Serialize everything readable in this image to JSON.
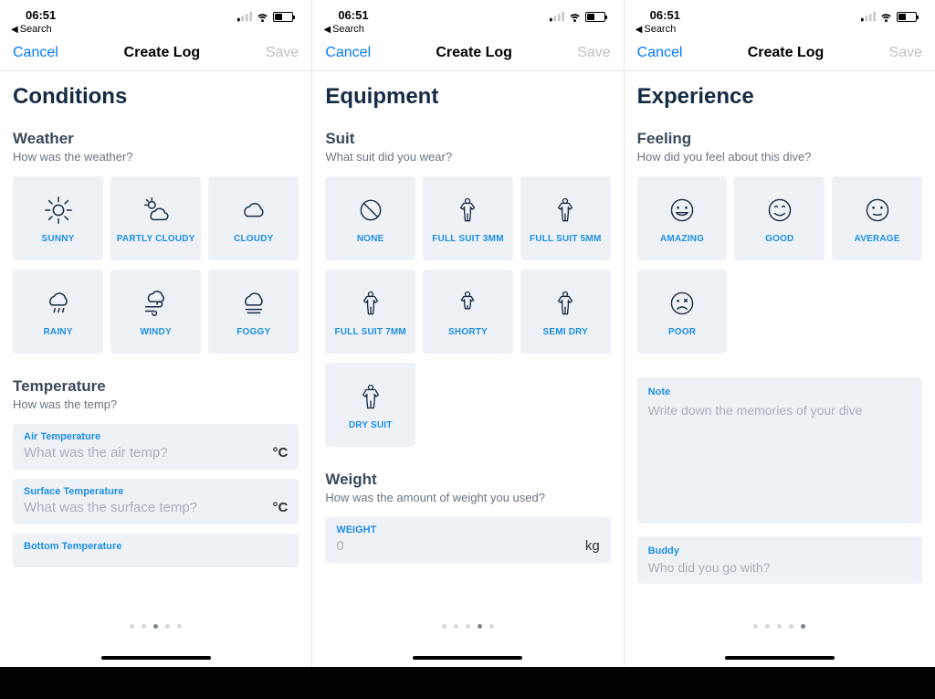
{
  "status": {
    "time": "06:51",
    "back": "Search"
  },
  "nav": {
    "cancel": "Cancel",
    "title": "Create Log",
    "save": "Save"
  },
  "s1": {
    "h1": "Conditions",
    "weather": {
      "title": "Weather",
      "sub": "How was the weather?",
      "tiles": [
        "SUNNY",
        "PARTLY CLOUDY",
        "CLOUDY",
        "RAINY",
        "WINDY",
        "FOGGY"
      ]
    },
    "temp": {
      "title": "Temperature",
      "sub": "How was the temp?",
      "air_label": "Air Temperature",
      "air_ph": "What was the air temp?",
      "unit": "°C",
      "surf_label": "Surface Temperature",
      "surf_ph": "What was the surface temp?",
      "bot_label": "Bottom Temperature"
    },
    "dots_active": 2
  },
  "s2": {
    "h1": "Equipment",
    "suit": {
      "title": "Suit",
      "sub": "What suit did you wear?",
      "tiles": [
        "NONE",
        "FULL SUIT 3MM",
        "FULL SUIT 5MM",
        "FULL SUIT 7MM",
        "SHORTY",
        "SEMI DRY",
        "DRY SUIT"
      ]
    },
    "weight": {
      "title": "Weight",
      "sub": "How was the amount of weight you used?",
      "label": "WEIGHT",
      "value": "0",
      "unit": "kg"
    },
    "dots_active": 3
  },
  "s3": {
    "h1": "Experience",
    "feel": {
      "title": "Feeling",
      "sub": "How did you feel about this dive?",
      "tiles": [
        "AMAZING",
        "GOOD",
        "AVERAGE",
        "POOR"
      ]
    },
    "note": {
      "label": "Note",
      "ph": "Write down the memories of your dive"
    },
    "buddy": {
      "label": "Buddy",
      "ph": "Who did you go with?"
    },
    "dots_active": 4
  }
}
